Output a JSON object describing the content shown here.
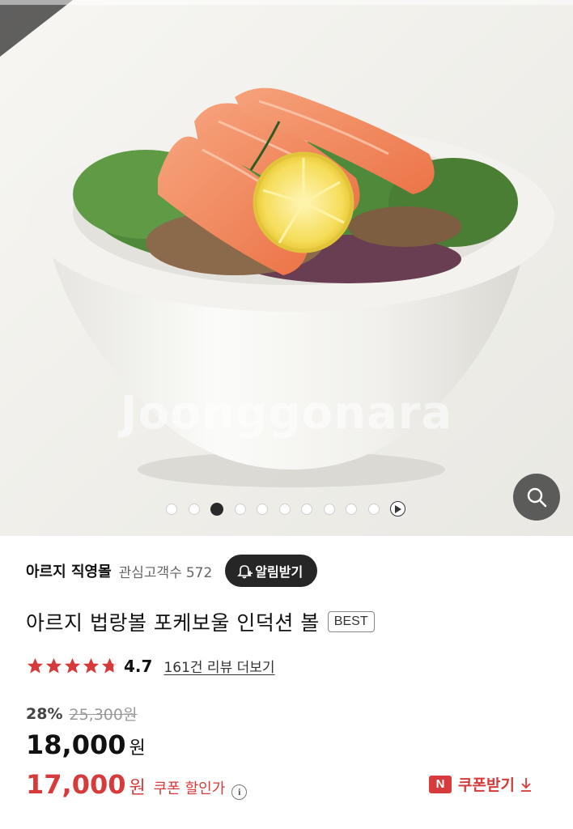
{
  "gallery": {
    "watermark": "Joonggonara",
    "dot_count": 10,
    "active_dot_index": 2,
    "zoom_icon": "search-icon",
    "play_icon": "play-icon"
  },
  "seller": {
    "name": "아르지 직영몰",
    "fans_label": "관심고객수",
    "fans_count": "572",
    "notify_label": "알림받기",
    "notify_icon": "bell-plus-icon"
  },
  "product": {
    "title": "아르지 법랑볼 포케보울 인덕션 볼",
    "badge": "BEST"
  },
  "rating": {
    "stars": 4.7,
    "value": "4.7",
    "review_link": "161건 리뷰 더보기"
  },
  "price": {
    "discount_percent": "28%",
    "original": "25,300원",
    "sale_number": "18,000",
    "sale_unit": "원",
    "coupon_number": "17,000",
    "coupon_unit": "원",
    "coupon_label": "쿠폰 할인가",
    "info_icon": "info-icon"
  },
  "coupon_button": {
    "badge": "N",
    "label": "쿠폰받기",
    "icon": "download-icon"
  },
  "colors": {
    "accent_red": "#d63a3a",
    "dark_button": "#262626",
    "star": "#d63a3a"
  }
}
